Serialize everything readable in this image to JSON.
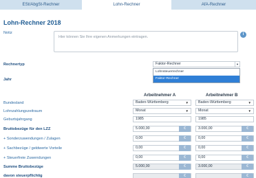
{
  "tabs": [
    {
      "label": "ESt/AbgSt-Rechner"
    },
    {
      "label": "Lohn-Rechner"
    },
    {
      "label": "AfA-Rechner"
    }
  ],
  "title": "Lohn-Rechner 2018",
  "notiz": {
    "label": "Notiz",
    "placeholder": "Hier können Sie Ihre eigenen Anmerkungen eintragen."
  },
  "rechnertyp": {
    "label": "Rechnertyp",
    "selected": "Faktor-Rechner",
    "options": [
      "Lohnsteuerrechner",
      "Faktor-Rechner"
    ]
  },
  "jahr": {
    "label": "Jahr"
  },
  "columns": {
    "a": "Arbeitnehmer A",
    "b": "Arbeitnehmer B"
  },
  "rows": {
    "bundesland": {
      "label": "Bundesland",
      "a": "Baden-Württemberg",
      "b": "Baden-Württemberg"
    },
    "zeitraum": {
      "label": "Lohnzahlungszeitraum",
      "a": "Monat",
      "b": "Monat"
    },
    "geburtsjahr": {
      "label": "Geburtsjahrgang",
      "a": "1985",
      "b": "1985"
    },
    "brutto": {
      "label": "Bruttobezüge für den LZZ",
      "a": "5.000,00",
      "b": "3.000,00"
    },
    "sonder": {
      "label": "+ Sonderzuwendungen / Zulagen",
      "a": "0,00",
      "b": "0,00"
    },
    "sachbezug": {
      "label": "+ Sachbezüge / geldwerte Vorteile",
      "a": "0,00",
      "b": "0,00"
    },
    "steuerfrei": {
      "label": "+ Steuerfreie Zuwendungen",
      "a": "0,00",
      "b": "0,00"
    },
    "summe": {
      "label": "Summe Bruttobezüge",
      "a": "5.000,00",
      "b": "3.000,00"
    },
    "steuerpfl": {
      "label": "davon steuerpflichtig"
    }
  },
  "currency": "€"
}
